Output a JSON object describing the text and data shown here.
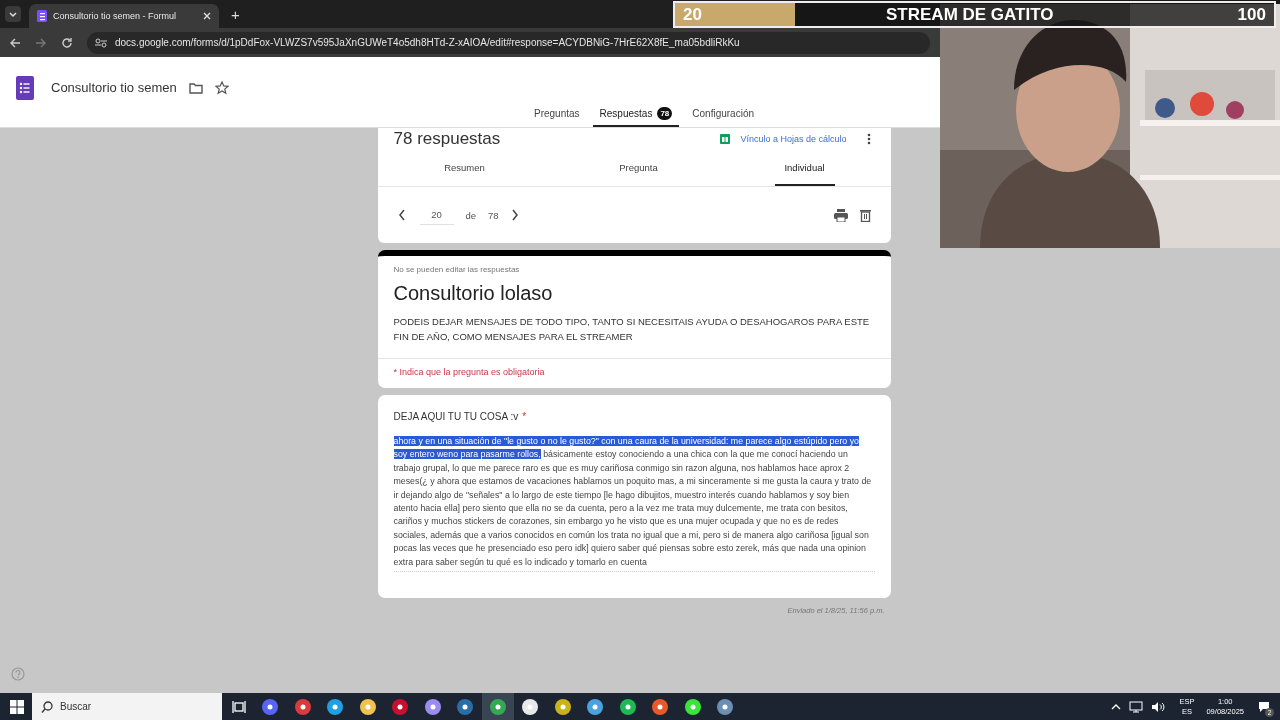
{
  "browser": {
    "tab_title": "Consultorio tio semen - Formul",
    "new_tab": "+",
    "url": "docs.google.com/forms/d/1pDdFox-VLWZS7v595JaXnGUWeT4o5dh8HTd-Z-xAIOA/edit#response=ACYDBNiG-7HrE62X8fE_ma05bdliRkKu"
  },
  "form_header": {
    "title": "Consultorio tio semen",
    "tabs": [
      {
        "label": "Preguntas",
        "selected": false
      },
      {
        "label": "Respuestas",
        "selected": true,
        "badge": "78"
      },
      {
        "label": "Configuración",
        "selected": false
      }
    ]
  },
  "responses_card": {
    "count": "78 respuestas",
    "sheets_link": "Vínculo a Hojas de cálculo",
    "tabs": [
      {
        "label": "Resumen",
        "selected": false
      },
      {
        "label": "Pregunta",
        "selected": false
      },
      {
        "label": "Individual",
        "selected": true
      }
    ],
    "pager": {
      "current": "20",
      "of": "de",
      "total": "78"
    }
  },
  "form_card": {
    "notice": "No se pueden editar las respuestas",
    "title": "Consultorio lolaso",
    "description": "PODEIS DEJAR MENSAJES DE TODO TIPO, TANTO SI NECESITAIS AYUDA O DESAHOGAROS PARA ESTE FIN DE AÑO, COMO MENSAJES PARA EL STREAMER",
    "required_note": "* Indica que la pregunta es obligatoria"
  },
  "question": {
    "title": "DEJA AQUI TU TU COSA :v",
    "required": true,
    "required_mark": "*",
    "answer": [
      {
        "text": "ahora y en una situación de \"le gusto o no le gusto?\" con una caura de la universidad: me parece algo estúpido pero yo soy entero weno para pasarme rollos,",
        "selected": true
      },
      {
        "text": " básicamente estoy conociendo a una chica con la que me conocí haciendo un trabajo grupal, lo que me parece raro es que es muy cariñosa conmigo sin razon alguna, nos hablamos hace aprox 2 meses(¿ y ahora que estamos de vacaciones hablamos un poquito mas, a mi sinceramente si me gusta la caura y trato de ir dejando algo de \"señales\" a lo largo de este tiempo [le hago dibujitos, muestro interés cuando hablamos y soy bien atento hacia ella] pero siento que ella no se da cuenta, pero a la vez me trata muy dulcemente, me trata con besitos, cariños y muchos stickers de corazones, sin embargo yo he visto que es una mujer ocupada y que no es de redes sociales, además que a varios conocidos en común los trata no igual que a mi, pero si de manera algo cariñosa [igual son pocas las veces que he presenciado eso pero idk] quiero saber qué piensas sobre esto zerek, más que nada una opinion extra para saber según tu qué es lo indicado y tomarlo en cuenta",
        "selected": false
      }
    ]
  },
  "submitted": "Enviado el 1/8/25, 11:56 p.m.",
  "stream_goal": {
    "current": "20",
    "title": "STREAM DE GATITO",
    "target": "100",
    "level": 0.2
  },
  "taskbar": {
    "search_placeholder": "Buscar",
    "apps": [
      {
        "color": "#5865f2",
        "active": false
      },
      {
        "color": "#d83b3b",
        "active": false
      },
      {
        "color": "#1fa0e0",
        "active": false
      },
      {
        "color": "#f2c14e",
        "active": false
      },
      {
        "color": "#c8102e",
        "active": false
      },
      {
        "color": "#9b8cf0",
        "active": false
      },
      {
        "color": "#2a6ea8",
        "active": false
      },
      {
        "color": "#34a853",
        "active": true
      },
      {
        "color": "#e8e8e8",
        "active": false
      },
      {
        "color": "#c9b21a",
        "active": false
      },
      {
        "color": "#4aa3df",
        "active": false
      },
      {
        "color": "#1db954",
        "active": false
      },
      {
        "color": "#e8582a",
        "active": false
      },
      {
        "color": "#39e53a",
        "active": false
      },
      {
        "color": "#6c8fb3",
        "active": false
      }
    ],
    "language": "ESP",
    "layout": "ES",
    "time": "1:00",
    "date": "09/08/2025",
    "notifications": "2"
  }
}
